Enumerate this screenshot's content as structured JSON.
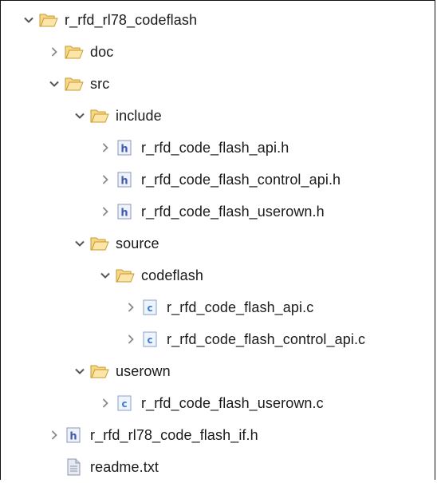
{
  "tree": {
    "items": [
      {
        "name": "folder-r_rfd_rl78_codeflash",
        "label": "r_rfd_rl78_codeflash",
        "type": "folder",
        "expanded": true
      },
      {
        "name": "folder-doc",
        "label": "doc",
        "type": "folder",
        "expanded": false
      },
      {
        "name": "folder-src",
        "label": "src",
        "type": "folder",
        "expanded": true
      },
      {
        "name": "folder-include",
        "label": "include",
        "type": "folder",
        "expanded": true
      },
      {
        "name": "file-r_rfd_code_flash_api-h",
        "label": "r_rfd_code_flash_api.h",
        "type": "header",
        "expanded": false
      },
      {
        "name": "file-r_rfd_code_flash_control_api-h",
        "label": "r_rfd_code_flash_control_api.h",
        "type": "header",
        "expanded": false
      },
      {
        "name": "file-r_rfd_code_flash_userown-h",
        "label": "r_rfd_code_flash_userown.h",
        "type": "header",
        "expanded": false
      },
      {
        "name": "folder-source",
        "label": "source",
        "type": "folder",
        "expanded": true
      },
      {
        "name": "folder-codeflash",
        "label": "codeflash",
        "type": "folder",
        "expanded": true
      },
      {
        "name": "file-r_rfd_code_flash_api-c",
        "label": "r_rfd_code_flash_api.c",
        "type": "csource",
        "expanded": false
      },
      {
        "name": "file-r_rfd_code_flash_control_api-c",
        "label": "r_rfd_code_flash_control_api.c",
        "type": "csource",
        "expanded": false
      },
      {
        "name": "folder-userown",
        "label": "userown",
        "type": "folder",
        "expanded": true
      },
      {
        "name": "file-r_rfd_code_flash_userown-c",
        "label": "r_rfd_code_flash_userown.c",
        "type": "csource",
        "expanded": false
      },
      {
        "name": "file-r_rfd_rl78_code_flash_if-h",
        "label": "r_rfd_rl78_code_flash_if.h",
        "type": "header",
        "expanded": false
      },
      {
        "name": "file-readme-txt",
        "label": "readme.txt",
        "type": "text",
        "expanded": null
      }
    ]
  },
  "colors": {
    "folder_fill": "#f5d88a",
    "folder_stroke": "#c99a2e",
    "header_icon": "#3f5bb0",
    "csource_icon": "#3a7bd5",
    "chevron": "#555555"
  }
}
